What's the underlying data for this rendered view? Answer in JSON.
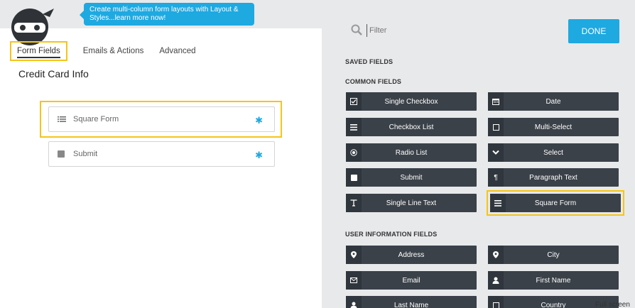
{
  "banner": {
    "text": "Create multi-column form layouts with Layout & Styles...learn more now!"
  },
  "tabs": [
    {
      "label": "Form Fields"
    },
    {
      "label": "Emails & Actions"
    },
    {
      "label": "Advanced"
    }
  ],
  "form": {
    "title": "Credit Card Info",
    "fields": [
      {
        "label": "Square Form"
      },
      {
        "label": "Submit"
      }
    ]
  },
  "toolbar": {
    "filter_placeholder": "Filter",
    "done_label": "DONE"
  },
  "sections": {
    "saved": "SAVED FIELDS",
    "common": "COMMON FIELDS",
    "user_info": "USER INFORMATION FIELDS"
  },
  "common_fields": [
    {
      "label": "Single Checkbox",
      "icon": "check-square-icon"
    },
    {
      "label": "Date",
      "icon": "calendar-icon"
    },
    {
      "label": "Checkbox List",
      "icon": "list-icon"
    },
    {
      "label": "Multi-Select",
      "icon": "square-icon"
    },
    {
      "label": "Radio List",
      "icon": "radio-icon"
    },
    {
      "label": "Select",
      "icon": "chevron-down-icon"
    },
    {
      "label": "Submit",
      "icon": "square-filled-icon"
    },
    {
      "label": "Paragraph Text",
      "icon": "paragraph-icon"
    },
    {
      "label": "Single Line Text",
      "icon": "text-icon"
    },
    {
      "label": "Square Form",
      "icon": "list-icon"
    }
  ],
  "user_fields": [
    {
      "label": "Address",
      "icon": "map-pin-icon"
    },
    {
      "label": "City",
      "icon": "map-pin-icon"
    },
    {
      "label": "Email",
      "icon": "envelope-icon"
    },
    {
      "label": "First Name",
      "icon": "user-icon"
    },
    {
      "label": "Last Name",
      "icon": "user-icon"
    },
    {
      "label": "Country",
      "icon": "square-icon"
    }
  ],
  "fullscreen_label": "Full screen",
  "colors": {
    "accent": "#1ea9e1",
    "button_dark": "#3a4149",
    "highlight": "#f5c518"
  }
}
